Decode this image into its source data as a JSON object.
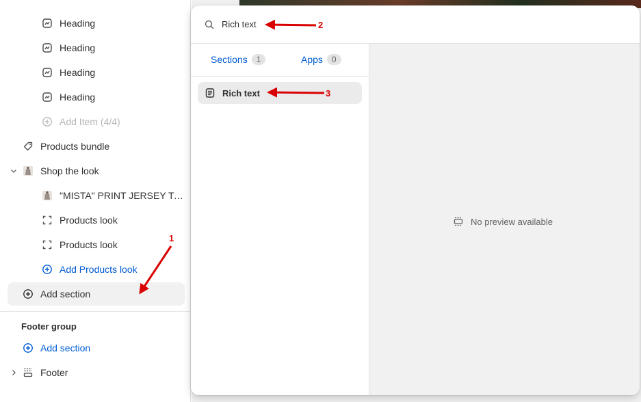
{
  "sidebar": {
    "rows": [
      {
        "label": "Heading",
        "icon": "heading-block-icon"
      },
      {
        "label": "Heading",
        "icon": "heading-block-icon"
      },
      {
        "label": "Heading",
        "icon": "heading-block-icon"
      },
      {
        "label": "Heading",
        "icon": "heading-block-icon"
      }
    ],
    "add_item_label": "Add Item (4/4)",
    "products_bundle_label": "Products bundle",
    "shop_the_look_label": "Shop the look",
    "product_label": "\"MISTA\" PRINT JERSEY T-S...",
    "products_look_1": "Products look",
    "products_look_2": "Products look",
    "add_products_look_label": "Add Products look",
    "add_section_label": "Add section",
    "footer_group_title": "Footer group",
    "footer_add_section_label": "Add section",
    "footer_label": "Footer"
  },
  "popover": {
    "search_value": "Rich text",
    "tabs": [
      {
        "label": "Sections",
        "count": "1"
      },
      {
        "label": "Apps",
        "count": "0"
      }
    ],
    "result_label": "Rich text",
    "no_preview_label": "No preview available"
  },
  "annotations": {
    "labels": [
      "1",
      "2",
      "3"
    ],
    "color": "#d90000"
  },
  "colors": {
    "accent_blue": "#005bd3",
    "text": "#303030",
    "muted": "#b5b5b5"
  }
}
